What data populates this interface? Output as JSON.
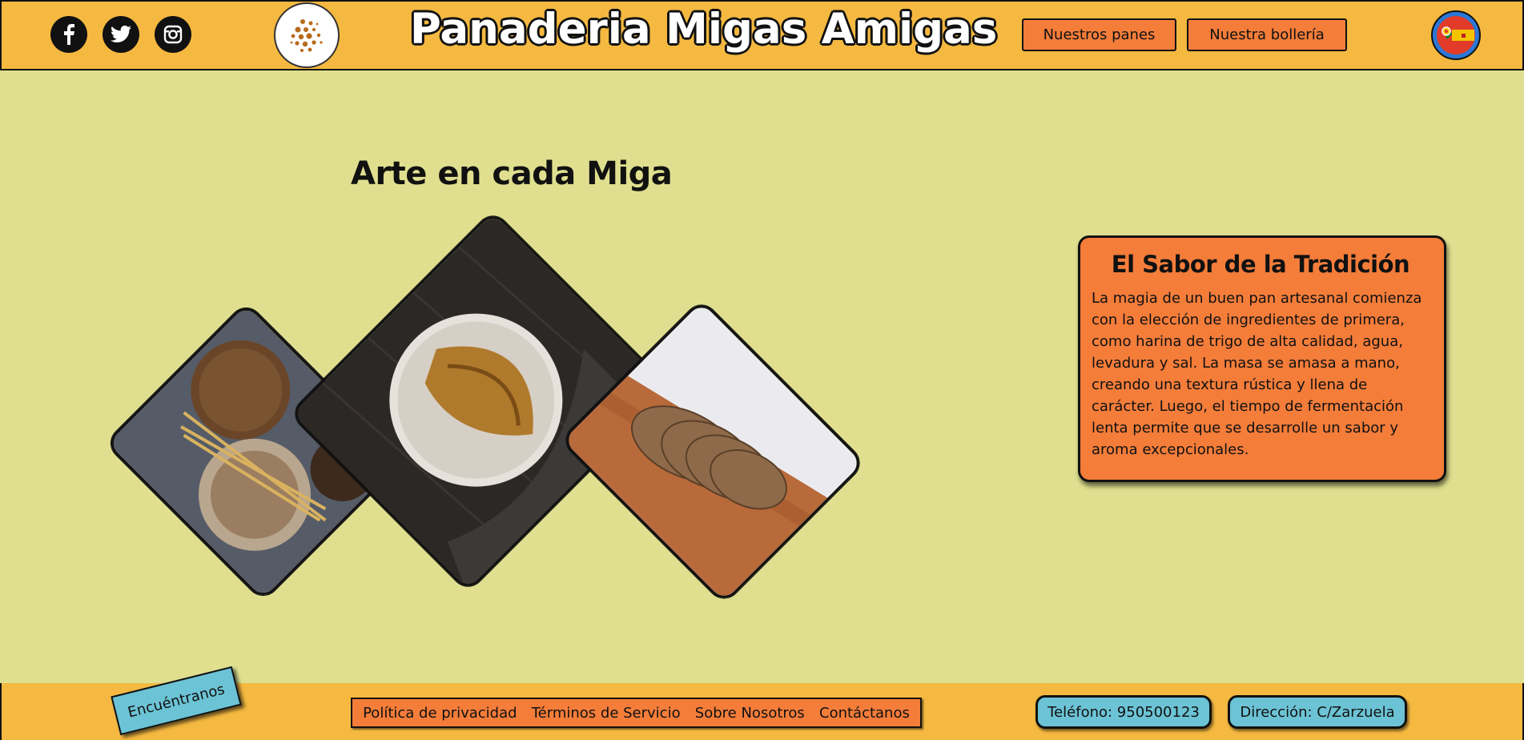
{
  "header": {
    "title": "Panaderia Migas Amigas",
    "social": [
      "facebook-icon",
      "twitter-icon",
      "instagram-icon"
    ],
    "nav": [
      "Nuestros panes",
      "Nuestra bollería"
    ],
    "language_icon": "language-flag-icon"
  },
  "main": {
    "gallery_title": "Arte en cada Miga",
    "photos": [
      "bread-rounds-with-wheat",
      "sourdough-loaf-on-wood",
      "sliced-bread-on-board"
    ],
    "card": {
      "title": "El Sabor de la Tradición",
      "text": "La magia de un buen pan artesanal comienza con la elección de ingredientes de primera, como harina de trigo de alta calidad, agua, levadura y sal. La masa se amasa a mano, creando una textura rústica y llena de carácter. Luego, el tiempo de fermentación lenta permite que se desarrolle un sabor y aroma excepcionales."
    }
  },
  "footer": {
    "find_us": "Encuéntranos",
    "links": [
      "Política de privacidad",
      "Términos de Servicio",
      "Sobre Nosotros",
      "Contáctanos"
    ],
    "phone": "Teléfono: 950500123",
    "address": "Dirección: C/Zarzuela"
  },
  "colors": {
    "header_bg": "#f5b941",
    "page_bg": "#dfdf8f",
    "accent_orange": "#f47d3a",
    "accent_blue": "#6cc3d5"
  }
}
